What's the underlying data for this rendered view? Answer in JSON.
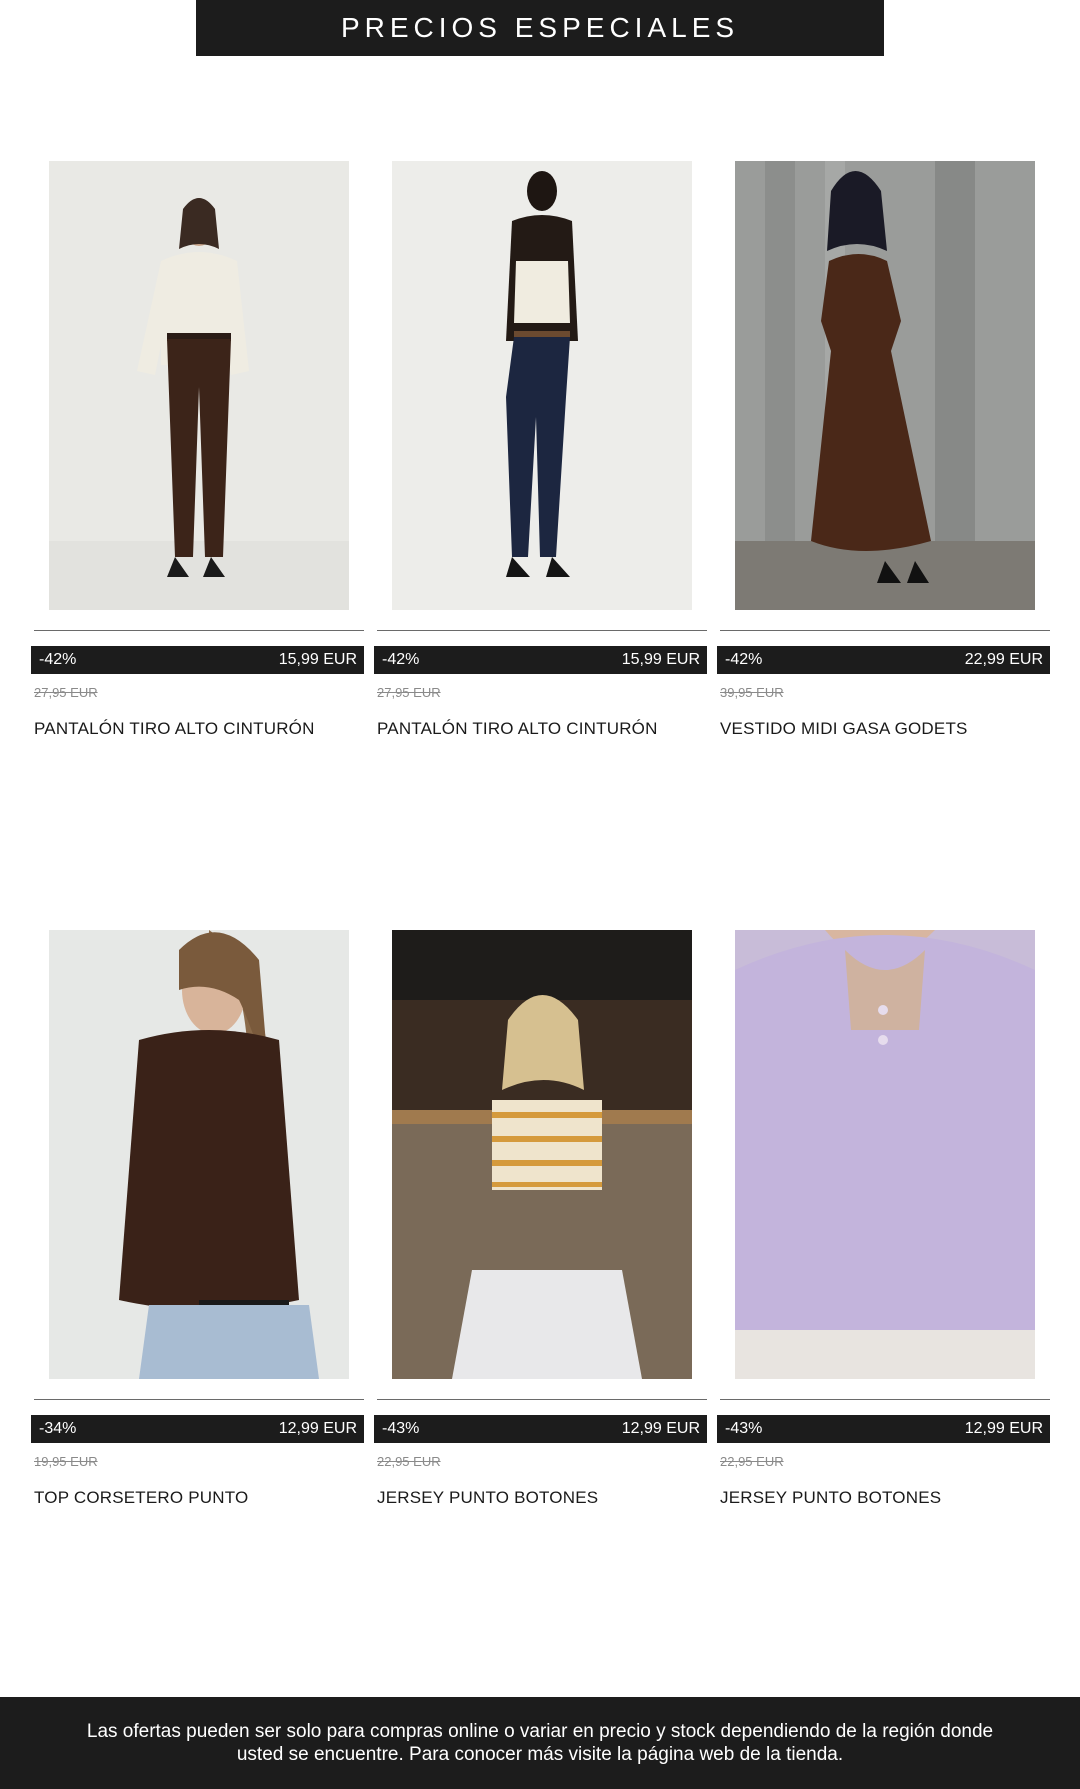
{
  "header": {
    "title": "PRECIOS ESPECIALES"
  },
  "products": [
    {
      "discount": "-42%",
      "price": "15,99 EUR",
      "old_price": "27,95 EUR",
      "name": "PANTALÓN TIRO ALTO CINTURÓN",
      "image": "woman-cream-top-brown-trousers"
    },
    {
      "discount": "-42%",
      "price": "15,99 EUR",
      "old_price": "27,95 EUR",
      "name": "PANTALÓN TIRO ALTO CINTURÓN",
      "image": "woman-strapless-top-navy-trousers"
    },
    {
      "discount": "-42%",
      "price": "22,99 EUR",
      "old_price": "39,95 EUR",
      "name": "VESTIDO MIDI GASA GODETS",
      "image": "woman-brown-midi-dress"
    },
    {
      "discount": "-34%",
      "price": "12,99 EUR",
      "old_price": "19,95 EUR",
      "name": "TOP CORSETERO PUNTO",
      "image": "woman-brown-knit-top"
    },
    {
      "discount": "-43%",
      "price": "12,99 EUR",
      "old_price": "22,95 EUR",
      "name": "JERSEY PUNTO BOTONES",
      "image": "woman-striped-knit-sweater"
    },
    {
      "discount": "-43%",
      "price": "12,99 EUR",
      "old_price": "22,95 EUR",
      "name": "JERSEY PUNTO BOTONES",
      "image": "lilac-knit-sweater"
    }
  ],
  "footer": {
    "disclaimer": "Las ofertas pueden ser solo para compras online o variar en precio y stock dependiendo de la región donde usted se encuentre. Para conocer más visite la página web de la tienda."
  }
}
